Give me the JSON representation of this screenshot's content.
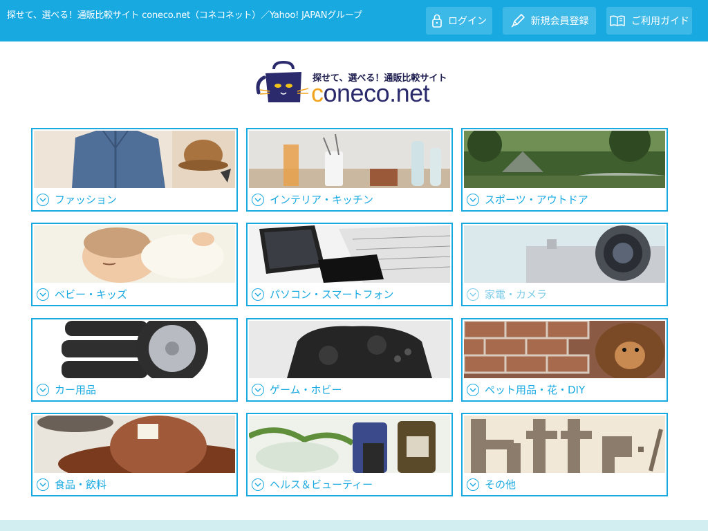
{
  "header": {
    "tagline": "探せて、選べる！通販比較サイト coneco.net（コネコネット）／Yahoo! JAPANグループ",
    "buttons": [
      {
        "label": "ログイン",
        "icon": "lock-icon"
      },
      {
        "label": "新規会員登録",
        "icon": "pen-icon"
      },
      {
        "label": "ご利用ガイド",
        "icon": "book-icon"
      }
    ]
  },
  "logo": {
    "tagline": "探せて、選べる！通販比較サイト",
    "wordmark_c": "c",
    "wordmark_rest": "oneco.net"
  },
  "categories": [
    {
      "label": "ファッション"
    },
    {
      "label": "インテリア・キッチン"
    },
    {
      "label": "スポーツ・アウトドア"
    },
    {
      "label": "ベビー・キッズ"
    },
    {
      "label": "パソコン・スマートフォン"
    },
    {
      "label": "家電・カメラ"
    },
    {
      "label": "カー用品"
    },
    {
      "label": "ゲーム・ホビー"
    },
    {
      "label": "ペット用品・花・DIY"
    },
    {
      "label": "食品・飲料"
    },
    {
      "label": "ヘルス＆ビューティー"
    },
    {
      "label": "その他"
    }
  ],
  "colors": {
    "header_bg": "#18a9e1",
    "accent": "#18a9e1",
    "footer_strip": "#d3eef0"
  }
}
